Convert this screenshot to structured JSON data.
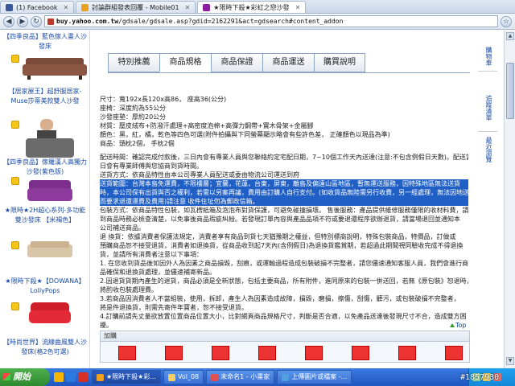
{
  "browser": {
    "tabs": [
      {
        "label": "(1) Facebook",
        "icon": "facebook-icon",
        "color": "#3b5998"
      },
      {
        "label": "討論群組發表回覆 - Mobile01",
        "icon": "mobile01-icon",
        "color": "#e8a020"
      },
      {
        "label": "★限時下殺★彩虹之戀沙發",
        "icon": "yahoo-icon",
        "color": "#8a1fa0"
      }
    ],
    "url_domain": "buy.yahoo.com.tw",
    "url_path": "/gdsale/gdsale.asp?gdid=2162291&act=gdsearch#content_addon"
  },
  "left_products": [
    {
      "name": "【四季良品】藍色傢人畫人沙發床"
    },
    {
      "name": "【居家屋王】超舒服居家-Muse莎蒂美款雙人沙發"
    },
    {
      "name": "【四季良品】傢羅漢人高獨力沙發(紫色版)"
    },
    {
      "name": "★限時★2H超心系列-多功能雙沙發床 【米褐色】"
    },
    {
      "name": "★限時下殺★【DOWANA】LollyPops"
    },
    {
      "name": "【時尚世界】流線曲風雙人沙發床(格2色可選)"
    }
  ],
  "product_tabs": [
    "特別推薦",
    "商品規格",
    "商品保證",
    "商品運送",
    "購買說明"
  ],
  "active_tab": "商品規格",
  "spec_lines": [
    "尺寸：寬192x長120x高86， 座高36(公分)",
    "座椅：深度約為55公分",
    "沙發座墊：厚約20公分",
    "材質：壓皮絨布+防潑汗處理+高密度泡棉+高彈力鋼帶+實木骨架+金屬腳",
    "顏色：黑，紅，橘，乾色等四色可選(附件拍攝與下同螢幕顯示略會有些許色差， 正確顏色以現品為準)",
    "商品：頭枕2個， 手枕2個"
  ],
  "para_lines": [
    "配送時間：確認完成付款後，三日內會有專業人員與您聯絡約定宅配日期，7~10個工作天內送達(注意:不包含例假日天數)。配送當",
    "日會有專業師傅與您協商到貨時間。",
    "送貨方式：依商品特性由本公司專業人員配送或委由物流公司運送到府"
  ],
  "hl_lines": [
    "送貨範圍：台灣本島免運費，不限樓層；宜蘭，花蓮，台東，屏東，離島及偏遠山區地區，暫無運送服務，因特殊地區無法送貨",
    "時，本公司保有出貨與否之權利，若需以另案再議，費用由訂購人自行支付。(如收貨品無陸需另行收費，另一經處理，無法因地送",
    "而要求退還運費及費用)請注意 收件住址勿為郵政信箱。"
  ],
  "para2_lines": [
    "包裝方式：依商品特性包裝，如瓦楞紙箱及泡泡布對貨保護，可避免碰撞損壞。 售後服務：產品提供維修服務僅限的收材料費，請於收",
    "到商品時務必檢查清楚，以免事後商品瑕疵糾紛。若發現訂單內容與產品品項不符或要退還程序欲辦退貨，請當場退回並通知本",
    "公司補送商品。",
    "退 換貨：依據消費者保護法規定，消費者享有商品到貨七天猶豫期之權益，但特別標商說明，特殊包裝商品，特價品，訂做或",
    "預購商品恕不接受退貨，消費者如退換貨，從商品收到起7天內(含例假日)為退換貨鑑賞期，若超過此期間視同驗收完成不得退換",
    "貨，並請所有消費者注意以下事項：",
    "1. 在您收到貨品後如因外人為因素之商品損毀，刮痕，或運輸過程造成包裝破損不完整者，請您儘速通知客服人員，我們會進行商",
    "品確保和退換貨處理，並儘速補寄新品。",
    "2.因退貨貨期內產生的退貨，商品必須是全新狀態，包括主要商品，所有附件，進同原來的包裝一併送回，若無《原包裝》恕退時，",
    "將酌收包裝處理費。",
    "3.若商品因消費者人不當組裝，使用，拆卸，產生人為因素造成故障，損毀，磨損，擦傷，刮傷，髒污，或包裝破損不完整者，",
    "將是件退換貨，則需先寄件年寶者，恕不接受退貨。",
    "4.訂購前請先丈量欲放置位置商品位置大小，比對網頁商品規格尺寸，判斷是否合適，以免產品送達後發現尺寸不合，造成雙方困",
    "擾。"
  ],
  "top_link": "Top",
  "addon_header": "加購",
  "right_links": [
    "購物車",
    "追蹤清單",
    "最近瀏覽"
  ],
  "taskbar": {
    "start_label": "開始",
    "buttons": [
      {
        "label": "★限時下殺★彩...",
        "color": "#f0a020"
      },
      {
        "label": "Vol_08",
        "color": "#f5d060"
      },
      {
        "label": "未命名1 - 小畫家",
        "color": "#e05050"
      },
      {
        "label": "上傳圖片或檔案 -...",
        "color": "#50a0e0"
      }
    ],
    "watermark": "#1857930"
  }
}
